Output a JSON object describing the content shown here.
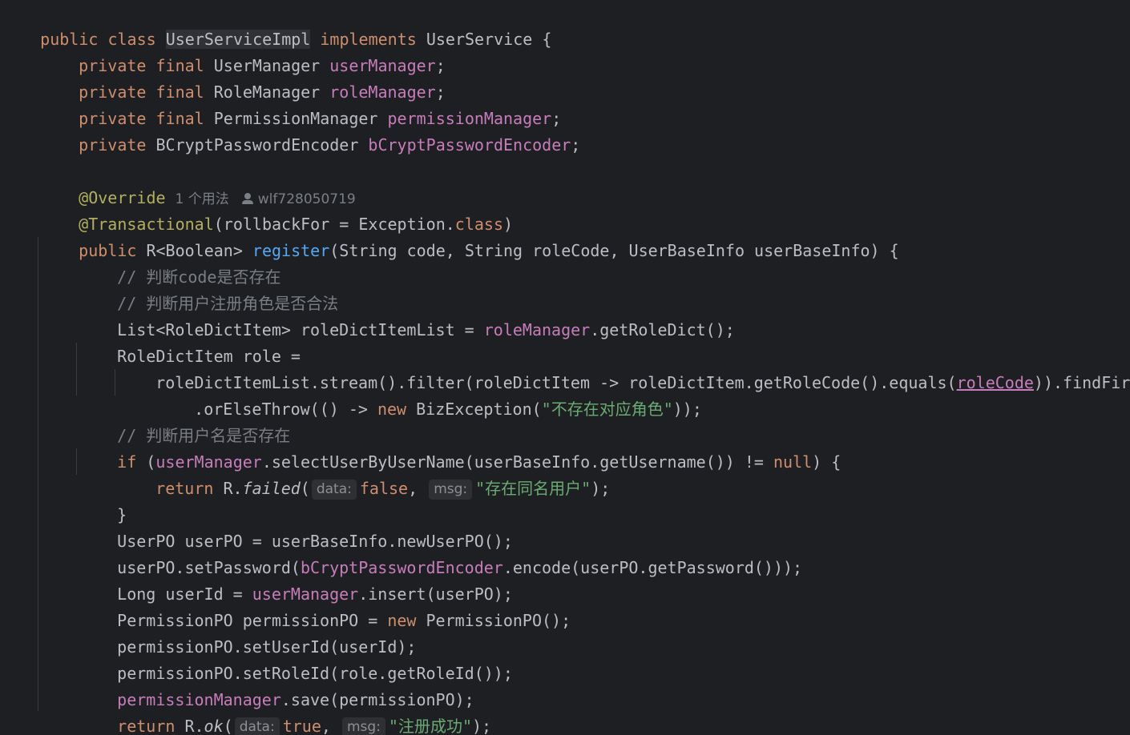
{
  "code": {
    "l1": {
      "kw": "public class ",
      "cls": "UserServiceImpl",
      "kw2": " implements",
      "rest": " UserService {"
    },
    "l2": {
      "kw": "private final",
      "type": " UserManager ",
      "fld": "userManager",
      "end": ";"
    },
    "l3": {
      "kw": "private final",
      "type": " RoleManager ",
      "fld": "roleManager",
      "end": ";"
    },
    "l4": {
      "kw": "private final",
      "type": " PermissionManager ",
      "fld": "permissionManager",
      "end": ";"
    },
    "l5": {
      "kw": "private",
      "type": " BCryptPasswordEncoder ",
      "fld": "bCryptPasswordEncoder",
      "end": ";"
    },
    "l7": {
      "ann": "@Override",
      "usages": "1 个用法",
      "author": "wlf728050719"
    },
    "l8": {
      "ann": "@Transactional",
      "p1": "(rollbackFor = Exception.",
      "kw": "class",
      "p2": ")"
    },
    "l9": {
      "kw": "public",
      "p1": " R<Boolean> ",
      "fn": "register",
      "p2": "(String code, String roleCode, UserBaseInfo userBaseInfo) {"
    },
    "l10": {
      "cmt": "// 判断code是否存在"
    },
    "l11": {
      "cmt": "// 判断用户注册角色是否合法"
    },
    "l12": {
      "p1": "List<RoleDictItem> roleDictItemList = ",
      "fld": "roleManager",
      "p2": ".getRoleDict();"
    },
    "l13": {
      "p1": "RoleDictItem role ="
    },
    "l14": {
      "p1": "roleDictItemList.stream().filter(roleDictItem -> roleDictItem.getRoleCode().equals(",
      "ul": "roleCode",
      "p2": ")).findFirst()"
    },
    "l15": {
      "p1": ".orElseThrow(() -> ",
      "kw": "new",
      "p2": " BizException(",
      "str": "\"不存在对应角色\"",
      "p3": "));"
    },
    "l16": {
      "cmt": "// 判断用户名是否存在"
    },
    "l17": {
      "kw": "if",
      "p1": " (",
      "fld": "userManager",
      "p2": ".selectUserByUserName(userBaseInfo.getUsername()) != ",
      "kw2": "null",
      "p3": ") {"
    },
    "l18": {
      "kw": "return",
      "p1": " R.",
      "fn": "failed",
      "p2": "(",
      "hint1": "data:",
      "kw2": "false",
      "p3": ",",
      "hint2": "msg:",
      "str": "\"存在同名用户\"",
      "p4": ");"
    },
    "l19": {
      "p1": "}"
    },
    "l20": {
      "p1": "UserPO userPO = userBaseInfo.newUserPO();"
    },
    "l21": {
      "p1": "userPO.setPassword(",
      "fld": "bCryptPasswordEncoder",
      "p2": ".encode(userPO.getPassword()));"
    },
    "l22": {
      "p1": "Long userId = ",
      "fld": "userManager",
      "p2": ".insert(userPO);"
    },
    "l23": {
      "p1": "PermissionPO permissionPO = ",
      "kw": "new",
      "p2": " PermissionPO();"
    },
    "l24": {
      "p1": "permissionPO.setUserId(userId);"
    },
    "l25": {
      "p1": "permissionPO.setRoleId(role.getRoleId());"
    },
    "l26": {
      "fld": "permissionManager",
      "p1": ".save(permissionPO);"
    },
    "l27": {
      "kw": "return",
      "p1": " R.",
      "fn": "ok",
      "p2": "(",
      "hint1": "data:",
      "kw2": "true",
      "p3": ",",
      "hint2": "msg:",
      "str": "\"注册成功\"",
      "p4": ");"
    },
    "l28": {
      "p1": "}"
    }
  },
  "colors": {
    "background": "#1e1f22",
    "keyword": "#cf8e6d",
    "field": "#c77dbb",
    "method": "#56a8f5",
    "annotation": "#b3ae60",
    "string": "#6aab73",
    "comment": "#7a7e85",
    "text": "#bcbec4"
  },
  "icons": {
    "author": "user-icon"
  }
}
